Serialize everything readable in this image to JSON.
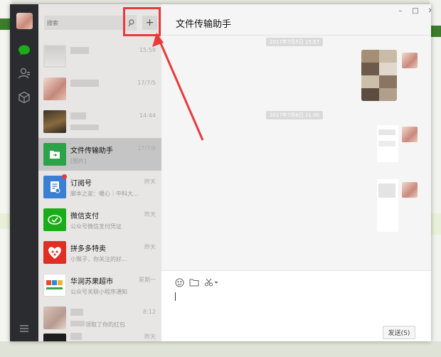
{
  "search": {
    "placeholder": "搜索"
  },
  "list_actions": {
    "add_label": "+"
  },
  "chats": [
    {
      "time": "15:59"
    },
    {
      "time": "17/7/5"
    },
    {
      "time": "14:44"
    },
    {
      "name": "文件传输助手",
      "preview": "[图片]",
      "time": "17/7/6"
    },
    {
      "name": "订阅号",
      "preview": "脚本之家：暖心｜中科大...",
      "time": "昨天"
    },
    {
      "name": "微信支付",
      "preview": "公众号微信支付凭证",
      "time": "昨天"
    },
    {
      "name": "拼多多特卖",
      "preview": "小猴子，你关注的好...",
      "time": "昨天"
    },
    {
      "name": "华润苏果超市",
      "preview": "公众号关联小程序通知",
      "time": "星期一"
    },
    {
      "preview": "领取了你的红包",
      "time": "8:12"
    },
    {
      "time": "昨天"
    }
  ],
  "chat": {
    "title": "文件传输助手",
    "timestamps": [
      "2017年7月5日 15:57",
      "2017年7月6日 11:00"
    ],
    "send_label": "发送(S)"
  },
  "window_controls": {
    "minimize": "–",
    "maximize": "□",
    "close": "✕"
  },
  "colors": {
    "highlight": "#e83a3a",
    "rail": "#2b2c2f",
    "accent_green": "#1aad19"
  }
}
